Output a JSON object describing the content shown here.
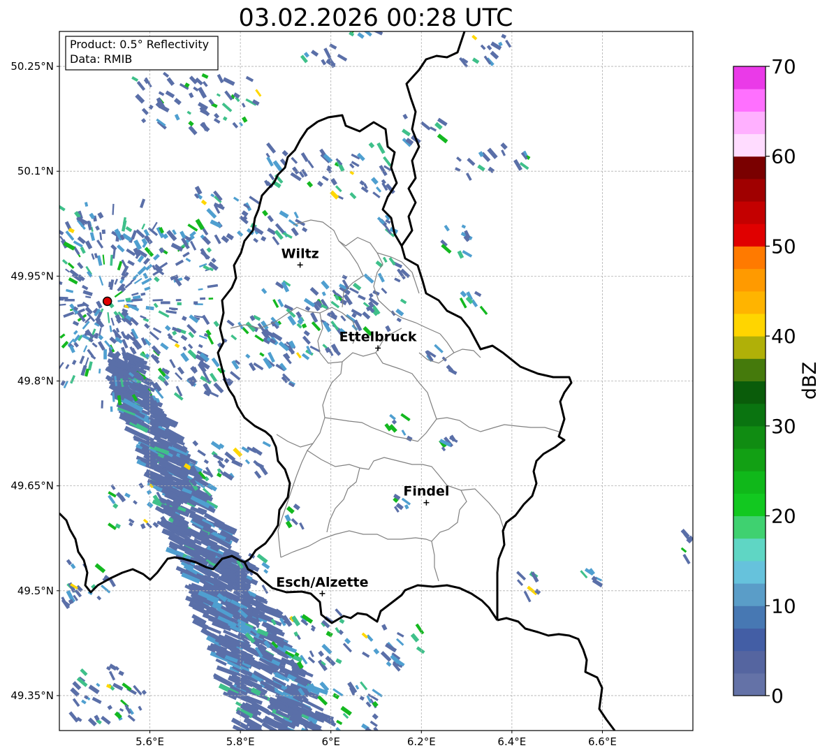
{
  "title": "03.02.2026 00:28 UTC",
  "info_box": {
    "product": "Product: 0.5° Reflectivity",
    "data_source": "Data: RMIB"
  },
  "map": {
    "lon_range": [
      5.4,
      6.8
    ],
    "lat_range": [
      49.3,
      50.3
    ],
    "lon_ticks": [
      {
        "value": 5.6,
        "label": "5.6°E"
      },
      {
        "value": 5.8,
        "label": "5.8°E"
      },
      {
        "value": 6.0,
        "label": "6°E"
      },
      {
        "value": 6.2,
        "label": "6.2°E"
      },
      {
        "value": 6.4,
        "label": "6.4°E"
      },
      {
        "value": 6.6,
        "label": "6.6°E"
      }
    ],
    "lat_ticks": [
      {
        "value": 50.25,
        "label": "50.25°N"
      },
      {
        "value": 50.1,
        "label": "50.1°N"
      },
      {
        "value": 49.95,
        "label": "49.95°N"
      },
      {
        "value": 49.8,
        "label": "49.8°N"
      },
      {
        "value": 49.65,
        "label": "49.65°N"
      },
      {
        "value": 49.5,
        "label": "49.5°N"
      },
      {
        "value": 49.35,
        "label": "49.35°N"
      }
    ],
    "gridlines": true,
    "radar_site": {
      "lon": 5.506,
      "lat": 49.914
    },
    "cities": [
      {
        "name": "Wiltz",
        "lon": 5.932,
        "lat": 49.966
      },
      {
        "name": "Ettelbruck",
        "lon": 6.104,
        "lat": 49.847
      },
      {
        "name": "Findel",
        "lon": 6.211,
        "lat": 49.626
      },
      {
        "name": "Esch/Alzette",
        "lon": 5.981,
        "lat": 49.496
      }
    ],
    "echo_colors": {
      "weak": "#5a6fa8",
      "light": "#4f9fd0",
      "moderate": "#3fc08a",
      "green": "#14b820",
      "strong": "#ffd700"
    }
  },
  "colorbar": {
    "label": "dBZ",
    "min": 0,
    "max": 70,
    "step": 2.5,
    "ticks": [
      "0",
      "10",
      "20",
      "30",
      "40",
      "50",
      "60",
      "70"
    ],
    "colors": [
      "#6472a7",
      "#5565a0",
      "#435ea5",
      "#4778b3",
      "#5a9dc8",
      "#66c2dc",
      "#5fd6c4",
      "#3fd170",
      "#12c820",
      "#10b81a",
      "#12a014",
      "#108c12",
      "#0a7410",
      "#0a5c0a",
      "#457a0c",
      "#b0b008",
      "#ffd500",
      "#ffb400",
      "#ff9a00",
      "#ff7a00",
      "#e00000",
      "#c40000",
      "#a00000",
      "#7a0000",
      "#ffdcff",
      "#ffb0ff",
      "#ff70ff",
      "#ea3ae8"
    ]
  }
}
